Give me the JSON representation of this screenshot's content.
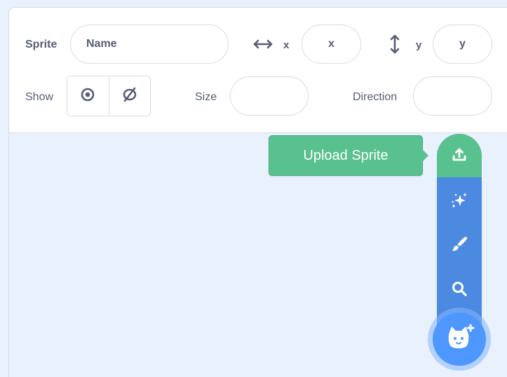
{
  "sprite_info": {
    "sprite_label": "Sprite",
    "name_placeholder": "Name",
    "x_label": "x",
    "x_placeholder": "x",
    "y_label": "y",
    "y_placeholder": "y",
    "show_label": "Show",
    "size_label": "Size",
    "size_value": "",
    "direction_label": "Direction",
    "direction_value": ""
  },
  "sprite_menu": {
    "tooltip": "Upload Sprite",
    "items": [
      {
        "icon": "upload-icon",
        "active": true
      },
      {
        "icon": "surprise-sparkle-icon",
        "active": false
      },
      {
        "icon": "paint-brush-icon",
        "active": false
      },
      {
        "icon": "search-icon",
        "active": false
      }
    ],
    "main_button_icon": "cat-add-icon"
  },
  "colors": {
    "text": "#575e75",
    "green": "#59c08f",
    "blue_menu": "#4c8ae2",
    "blue_button": "#4d97ff",
    "background": "#e9f1fc"
  }
}
